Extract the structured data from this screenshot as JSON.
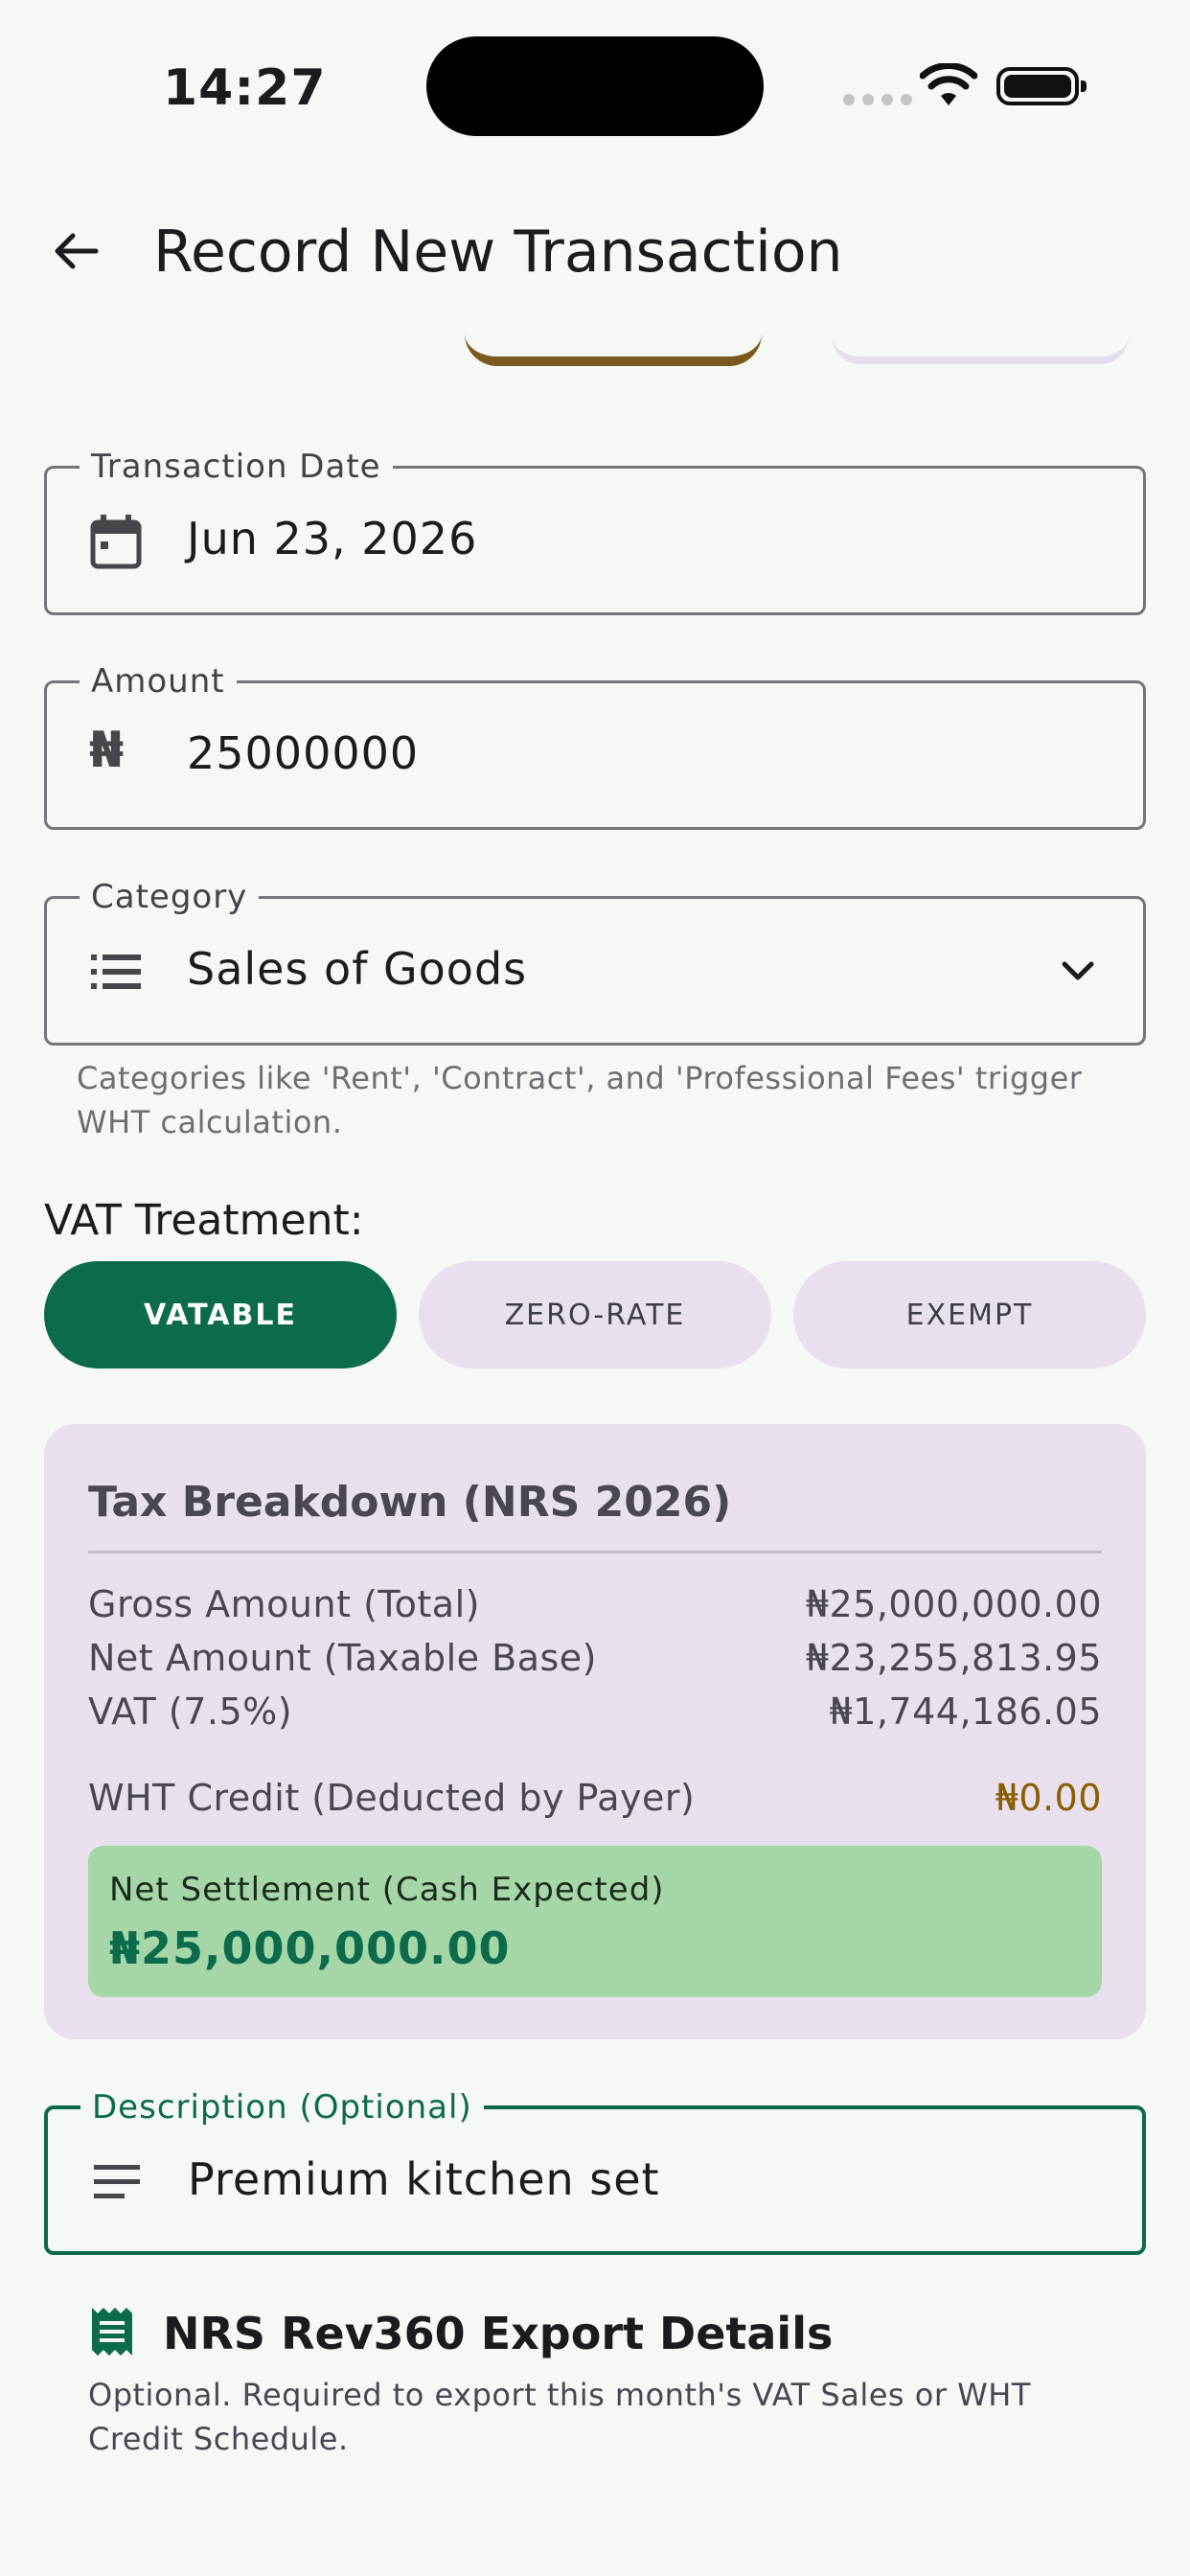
{
  "status": {
    "time": "14:27"
  },
  "app_bar": {
    "title": "Record New Transaction"
  },
  "fields": {
    "date": {
      "label": "Transaction Date",
      "value": "Jun 23, 2026"
    },
    "amount": {
      "label": "Amount",
      "currency_symbol": "₦",
      "value": "25000000"
    },
    "category": {
      "label": "Category",
      "value": "Sales of Goods",
      "helper": "Categories like 'Rent', 'Contract', and 'Professional Fees' trigger WHT calculation."
    },
    "description": {
      "label": "Description (Optional)",
      "value": "Premium kitchen set"
    }
  },
  "vat": {
    "label": "VAT Treatment:",
    "options": [
      "VATABLE",
      "ZERO-RATE",
      "EXEMPT"
    ],
    "selected": "VATABLE"
  },
  "tax": {
    "title": "Tax Breakdown (NRS 2026)",
    "rows": [
      {
        "label": "Gross Amount (Total)",
        "amount": "₦25,000,000.00"
      },
      {
        "label": "Net Amount (Taxable Base)",
        "amount": "₦23,255,813.95"
      },
      {
        "label": "VAT (7.5%)",
        "amount": "₦1,744,186.05"
      },
      {
        "label": "WHT Credit (Deducted by Payer)",
        "amount": "₦0.00"
      }
    ],
    "settlement": {
      "label": "Net Settlement (Cash Expected)",
      "amount": "₦25,000,000.00"
    }
  },
  "rev360": {
    "title": "NRS Rev360 Export Details",
    "subtitle": "Optional. Required to export this month's VAT Sales or WHT Credit Schedule."
  },
  "colors": {
    "primary": "#0c6b4c",
    "card": "#e9e0ee",
    "settle": "#a5d6a7",
    "wht": "#8a5d00"
  }
}
